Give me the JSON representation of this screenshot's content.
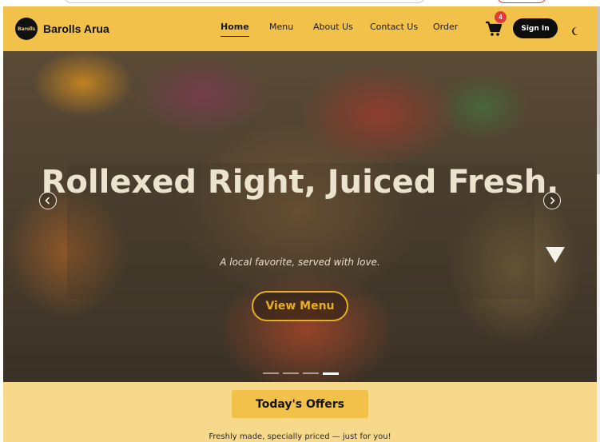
{
  "header": {
    "logo_text": "Barolls",
    "brand_name": "Barolls Arua",
    "nav": [
      {
        "label": "Home",
        "active": true
      },
      {
        "label": "Menu",
        "active": false
      },
      {
        "label": "About Us",
        "active": false
      },
      {
        "label": "Contact Us",
        "active": false
      },
      {
        "label": "Order",
        "active": false
      }
    ],
    "cart_count": "4",
    "signin_label": "Sign In",
    "icons": {
      "cart": "cart-icon",
      "theme": "moon-icon"
    }
  },
  "hero": {
    "title": "Rollexed Right, Juiced Fresh.",
    "subtitle": "A local favorite, served with love.",
    "cta_label": "View Menu",
    "slides": 4,
    "active_slide": 4
  },
  "offers": {
    "title": "Today's Offers",
    "subtitle": "Freshly made, specially priced — just for you!"
  },
  "colors": {
    "header_bg": "#f2c14a",
    "accent": "#e5b01f",
    "offers_bg": "#f7d98b",
    "badge": "#e03b3b",
    "dark": "#0d0d0d"
  }
}
